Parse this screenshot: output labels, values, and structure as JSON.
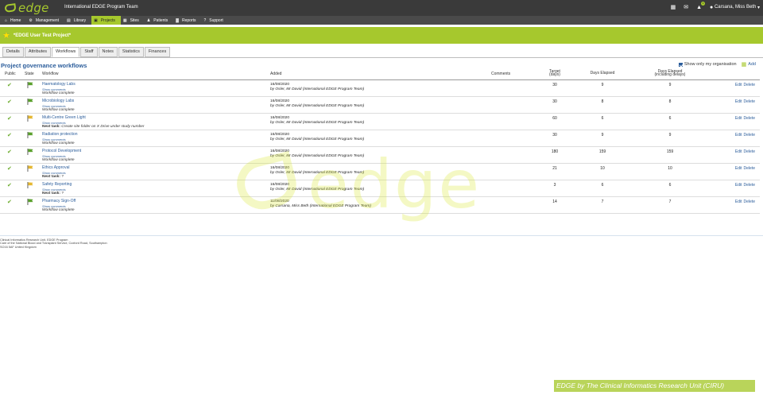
{
  "app": {
    "logo_text": "edge",
    "title": "International EDGE Program Team"
  },
  "user": {
    "name": "Carsana, Miss Beth",
    "notification_count": "1"
  },
  "nav": [
    {
      "label": "Home",
      "icon": "home-icon",
      "glyph": "⌂"
    },
    {
      "label": "Management",
      "icon": "gear-icon",
      "glyph": "⚙"
    },
    {
      "label": "Library",
      "icon": "book-icon",
      "glyph": "▤"
    },
    {
      "label": "Projects",
      "icon": "folder-icon",
      "glyph": "▣",
      "active": true
    },
    {
      "label": "Sites",
      "icon": "building-icon",
      "glyph": "▦"
    },
    {
      "label": "Patients",
      "icon": "person-icon",
      "glyph": "♟"
    },
    {
      "label": "Reports",
      "icon": "chart-icon",
      "glyph": "▓"
    },
    {
      "label": "Support",
      "icon": "question-icon",
      "glyph": "?"
    }
  ],
  "project": {
    "name": "*EDGE User Test Project*"
  },
  "tabs": [
    "Details",
    "Attributes",
    "Workflows",
    "Staff",
    "Notes",
    "Statistics",
    "Finances"
  ],
  "active_tab": "Workflows",
  "section": {
    "title": "Project governance workflows",
    "show_only_mine_label": "Show only my organisation",
    "add_label": "Add"
  },
  "columns": {
    "public": "Public",
    "state": "State",
    "workflow": "Workflow",
    "added": "Added",
    "comments": "Comments",
    "target_line1": "Target",
    "target_line2": "(days)",
    "days_elapsed": "Days Elapsed",
    "days_elapsed_delays_line1": "Days Elapsed",
    "days_elapsed_delays_line2": "(including delays)"
  },
  "show_comments_label": "Show comments",
  "next_task_label": "Next task:",
  "edit_label": "Edit",
  "delete_label": "Delete",
  "workflows": [
    {
      "name": "Haematology Labs",
      "status": "Workflow complete",
      "next_task": "",
      "added_date": "16/08/2020",
      "added_by": "by Osler, Mr David (International EDGE Program Team)",
      "target": "30",
      "elapsed": "9",
      "elapsed_delays": "9",
      "state": "green"
    },
    {
      "name": "Microbiology Labs",
      "status": "Workflow complete",
      "next_task": "",
      "added_date": "16/08/2020",
      "added_by": "by Osler, Mr David (International EDGE Program Team)",
      "target": "30",
      "elapsed": "8",
      "elapsed_delays": "8",
      "state": "green"
    },
    {
      "name": "Multi-Centre Green Light",
      "status": "",
      "next_task": "Create site folder on X Drive under study number",
      "added_date": "16/08/2020",
      "added_by": "by Osler, Mr David (International EDGE Program Team)",
      "target": "60",
      "elapsed": "6",
      "elapsed_delays": "6",
      "state": "amber"
    },
    {
      "name": "Radiation protection",
      "status": "Workflow complete",
      "next_task": "",
      "added_date": "16/08/2020",
      "added_by": "by Osler, Mr David (International EDGE Program Team)",
      "target": "30",
      "elapsed": "9",
      "elapsed_delays": "9",
      "state": "green"
    },
    {
      "name": "Protocol Development",
      "status": "Workflow complete",
      "next_task": "",
      "added_date": "16/08/2020",
      "added_by": "by Osler, Mr David (International EDGE Program Team)",
      "target": "180",
      "elapsed": "159",
      "elapsed_delays": "159",
      "state": "green"
    },
    {
      "name": "Ethics Approval",
      "status": "",
      "next_task": "?",
      "added_date": "16/08/2020",
      "added_by": "by Osler, Mr David (International EDGE Program Team)",
      "target": "21",
      "elapsed": "10",
      "elapsed_delays": "10",
      "state": "amber"
    },
    {
      "name": "Safety Reporting",
      "status": "",
      "next_task": "?",
      "added_date": "16/08/2020",
      "added_by": "by Osler, Mr David (International EDGE Program Team)",
      "target": "3",
      "elapsed": "6",
      "elapsed_delays": "6",
      "state": "amber"
    },
    {
      "name": "Pharmacy Sign-Off",
      "status": "Workflow complete",
      "next_task": "",
      "added_date": "11/08/2020",
      "added_by": "by Carsana, Miss Beth (International EDGE Program Team)",
      "target": "14",
      "elapsed": "7",
      "elapsed_delays": "7",
      "state": "green"
    }
  ],
  "footer": {
    "line1": "Clinical Informatics Research Unit, EDGE Program",
    "line2": "Care of the National Blood and Transplant Service, Coxford Road, Southampton",
    "line3": "SO16 5AF United Kingdom"
  },
  "watermark_text": "edge",
  "credit": "EDGE by The Clinical Informatics Research Unit (CIRU)",
  "colors": {
    "accent": "#a6c82d",
    "link": "#2b5d9b",
    "topbar": "#3a3a3a",
    "green_flag": "#5aa02c",
    "amber_flag": "#e5b730"
  }
}
